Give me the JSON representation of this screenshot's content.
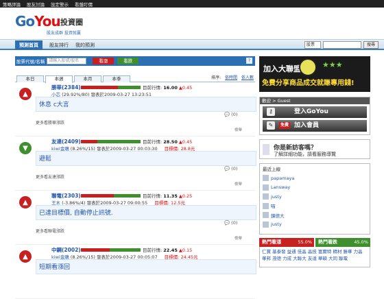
{
  "topbar": [
    "策略評論",
    "股友討論",
    "設定警示",
    "看盤盯價"
  ],
  "brand": {
    "logo_go": "Go",
    "logo_you": "You",
    "title": "投資圈",
    "slogan": "股友成群 投資就贏"
  },
  "nav": {
    "tabs": [
      "預測首頁",
      "股友排行",
      "我的預測"
    ],
    "search_select": "股票",
    "search_btn": "搜尋"
  },
  "filter": {
    "label": "股票代號/名稱",
    "placeholder": "請輸入股號/股名",
    "btn_up": "看漲",
    "btn_down": "看跌",
    "help": "?"
  },
  "period_tabs": [
    "本日",
    "本週",
    "本月",
    "本季"
  ],
  "sort": {
    "label": "排序:",
    "by_time": "依時間",
    "by_people": "依人數"
  },
  "posts": [
    {
      "direction": "up",
      "stock": "勝華(2384)",
      "target_label": "目標價:",
      "price_label": "目前行情:",
      "price": "16.00",
      "change": "▲0.45",
      "user": "小芯",
      "stat": "(29.92%/80)",
      "time": "發表於2009-03-27 13:23:51",
      "goal": "",
      "content": "休息 c大言",
      "thumb": "(0)",
      "more": "更多看勝華漲跌",
      "report": "檢舉",
      "up_ratio": 0.62
    },
    {
      "direction": "down",
      "stock": "友達(2409)",
      "price_label": "目前行情:",
      "price": "28.50",
      "change": "▲0.45",
      "user": "kiwi金鵰",
      "stat": "(8.26%/15)",
      "time": "發表於2009-03-27 00:03:30",
      "goal_label": "目標價:",
      "goal": "28.8元",
      "content": "避鬆",
      "thumb": "(0)",
      "more": "更多看友達漲跌",
      "report": "檢舉",
      "up_ratio": 0.28
    },
    {
      "direction": "up",
      "stock": "聯電(2303)",
      "price_label": "目前行情:",
      "price": "11.35",
      "change": "▲0.25",
      "user": "王木",
      "stat": "(-3.86%/4)",
      "time": "發表於2009-03-27 09:00:55",
      "goal_label": "目標價:",
      "goal": "12.5元",
      "content": "已達目標價, 自動停止訊號.",
      "thumb": "(0)",
      "more": "更多看聯電漲跌",
      "report": "檢舉",
      "up_ratio": 0.55
    },
    {
      "direction": "up",
      "stock": "中鋼(2002)",
      "price_label": "目前行情:",
      "price": "22.45",
      "change": "▲0.15",
      "user": "kiwi金鵰",
      "stat": "(8.26%/15)",
      "time": "發表於2009-03-27 00:05:07",
      "goal_label": "目標價:",
      "goal": "24.45元",
      "content": "短期看漲回",
      "thumb": "(0)",
      "more": "",
      "report": "",
      "up_ratio": 0.48
    }
  ],
  "banner": {
    "line1": "加入大聯盟",
    "line2": "免費分享商品成交就賺專用錢!"
  },
  "login": {
    "header": "歡迎 > Guest",
    "login_btn": "登入GoYou",
    "free": "免費",
    "join_btn": "加入會員"
  },
  "newbie": {
    "q1": "你是新訪客嗎？",
    "q2": "了解詳細功能，請看服務導覽"
  },
  "latest": {
    "header": "最近上線",
    "users": [
      "papamaya",
      "Lansway",
      "justy",
      "喵",
      "鍊德大",
      "justy"
    ]
  },
  "hot": {
    "up_label": "熱門看漲",
    "up_pct": "55.0%",
    "down_label": "熱門看跌",
    "down_pct": "45.0%",
    "tags": [
      "仁寶",
      "基泰發",
      "益通",
      "佳晶",
      "晶技",
      "富爾特",
      "精材",
      "勝華",
      "力晶",
      "華邦",
      "茂德",
      "力成",
      "大聯大",
      "友達",
      "華碩",
      "大同",
      "聯電"
    ]
  },
  "colors": {
    "red": "#c62020",
    "green": "#3f8f2f",
    "blue": "#2d6fb3"
  }
}
